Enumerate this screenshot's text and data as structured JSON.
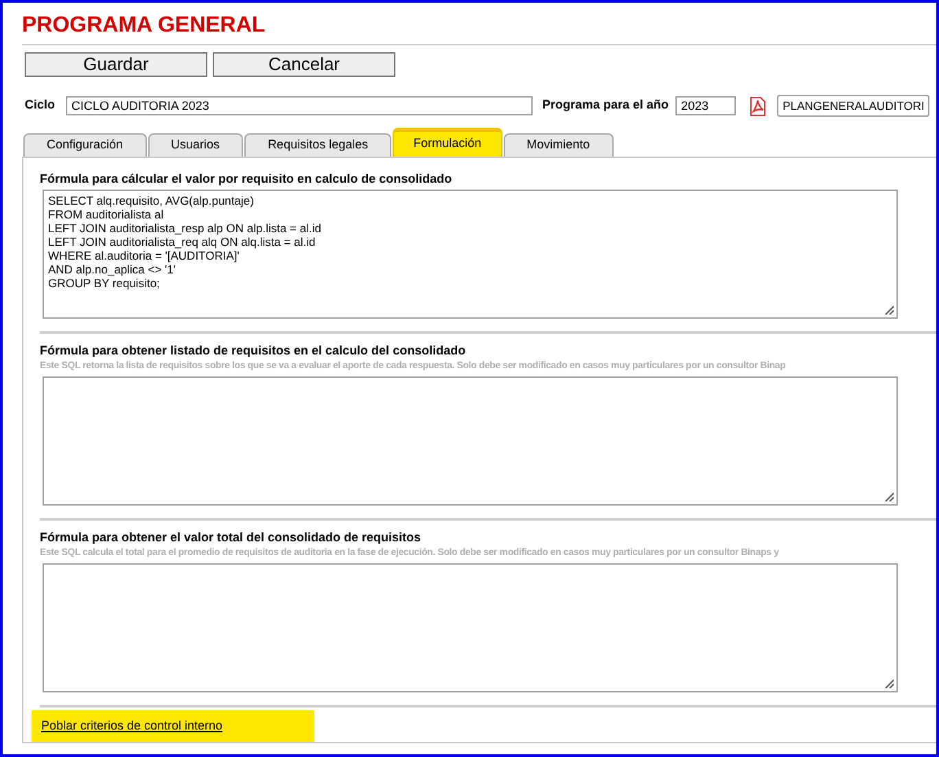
{
  "title": "PROGRAMA GENERAL",
  "buttons": [
    "Guardar",
    "Cancelar"
  ],
  "ciclo": {
    "label": "Ciclo",
    "value": "CICLO AUDITORIA 2023"
  },
  "year": {
    "label": "Programa para el año",
    "value": "2023"
  },
  "file": {
    "value": "PLANGENERALAUDITORI"
  },
  "tabs": [
    {
      "label": "Configuración",
      "selected": false
    },
    {
      "label": "Usuarios",
      "selected": false
    },
    {
      "label": "Requisitos legales",
      "selected": false
    },
    {
      "label": "Formulación",
      "selected": true
    },
    {
      "label": "Movimiento",
      "selected": false
    }
  ],
  "sections": [
    {
      "label": "Fórmula para cálcular el valor por requisito en calculo de consolidado",
      "value": "SELECT alq.requisito, AVG(alp.puntaje)\nFROM auditorialista al\nLEFT JOIN auditorialista_resp alp ON alp.lista = al.id\nLEFT JOIN auditorialista_req alq ON alq.lista = al.id\nWHERE al.auditoria = '[AUDITORIA]'\nAND alp.no_aplica <> '1'\nGROUP BY requisito;"
    },
    {
      "label": "Fórmula para obtener listado de requisitos en el calculo del consolidado",
      "description": "Este SQL retorna la lista de requisitos sobre los que se va a evaluar el aporte de cada respuesta. Solo debe ser modificado en casos muy particulares por un consultor Binap"
    },
    {
      "label": "Fórmula para obtener el valor total del consolidado de requisitos",
      "description": "Este SQL calcula el total para el promedio de requisitos de auditoria en la fase de ejecución. Solo debe ser modificado en casos muy particulares por un consultor Binaps y"
    }
  ],
  "link": {
    "label": "Poblar criterios de control interno",
    "highlighted": true
  }
}
